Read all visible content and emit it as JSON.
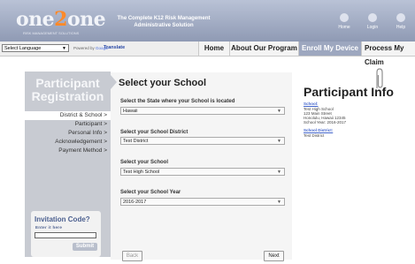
{
  "header": {
    "logo": {
      "pre": "one",
      "mid": "2",
      "post": "one"
    },
    "logo_sub": "RISK MANAGEMENT SOLUTIONS",
    "tagline": [
      "The Complete K12 Risk Management",
      "Administrative Solution"
    ],
    "icons": [
      {
        "label": "Home",
        "icon": "home-icon"
      },
      {
        "label": "Login",
        "icon": "login-icon"
      },
      {
        "label": "Help",
        "icon": "help-icon"
      }
    ]
  },
  "nav": {
    "language_select": "Select Language",
    "powered_by": "Powered by",
    "google": "Google",
    "translate": "Translate",
    "tabs": [
      "Home",
      "About Our Program",
      "Enroll My Device",
      "Process My Claim"
    ],
    "active_tab": "Enroll My Device"
  },
  "sidebar": {
    "title_line1": "Participant",
    "title_line2": "Registration",
    "steps": [
      "District & School >",
      "Participant >",
      "Personal Info >",
      "Acknowledgement >",
      "Payment Method >"
    ],
    "current_step": "District & School >",
    "invitation": {
      "title": "Invitation Code?",
      "subtitle": "Enter it here",
      "input_value": "",
      "submit": "Submit"
    }
  },
  "form": {
    "title": "Select your School",
    "fields": [
      {
        "label": "Select the State where your School is located",
        "value": "Hawaii"
      },
      {
        "label": "Select your School District",
        "value": "Test District"
      },
      {
        "label": "Select your School",
        "value": "Test High School"
      },
      {
        "label": "Select your School Year",
        "value": "2016-2017"
      }
    ],
    "back": "Back",
    "next": "Next"
  },
  "info": {
    "title": "Participant Info",
    "school_head": "School:",
    "school_lines": [
      "Test High School",
      "123 Main Street",
      "Honolulu, Hawaii 12345",
      "School Year: 2016-2017"
    ],
    "district_head": "School District:",
    "district_lines": [
      "Test District"
    ]
  },
  "colors": {
    "header": "#9da7bf",
    "accent_orange": "#ff8a2a",
    "sidebar": "#c8cbd2",
    "link_blue": "#4466cc"
  }
}
